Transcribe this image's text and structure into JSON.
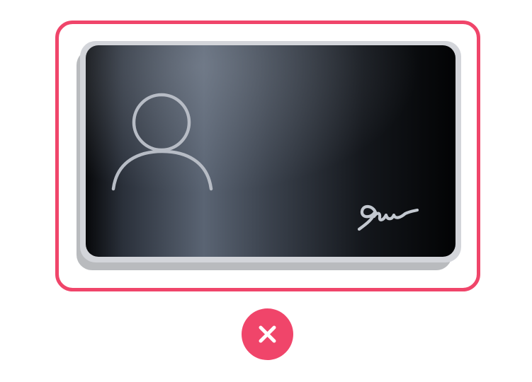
{
  "illustration": {
    "subject": "id-card-icon",
    "frame_color": "#f0456a",
    "card_colors": {
      "border": "#cfd1d6",
      "shadow": "#b9bbbe",
      "face_dark": "#050608",
      "face_light": "#5b6574",
      "line": "#c9ced6"
    },
    "status": "rejected"
  },
  "reject_button": {
    "icon": "close-icon",
    "color": "#f0456a",
    "icon_color": "#ffffff"
  }
}
